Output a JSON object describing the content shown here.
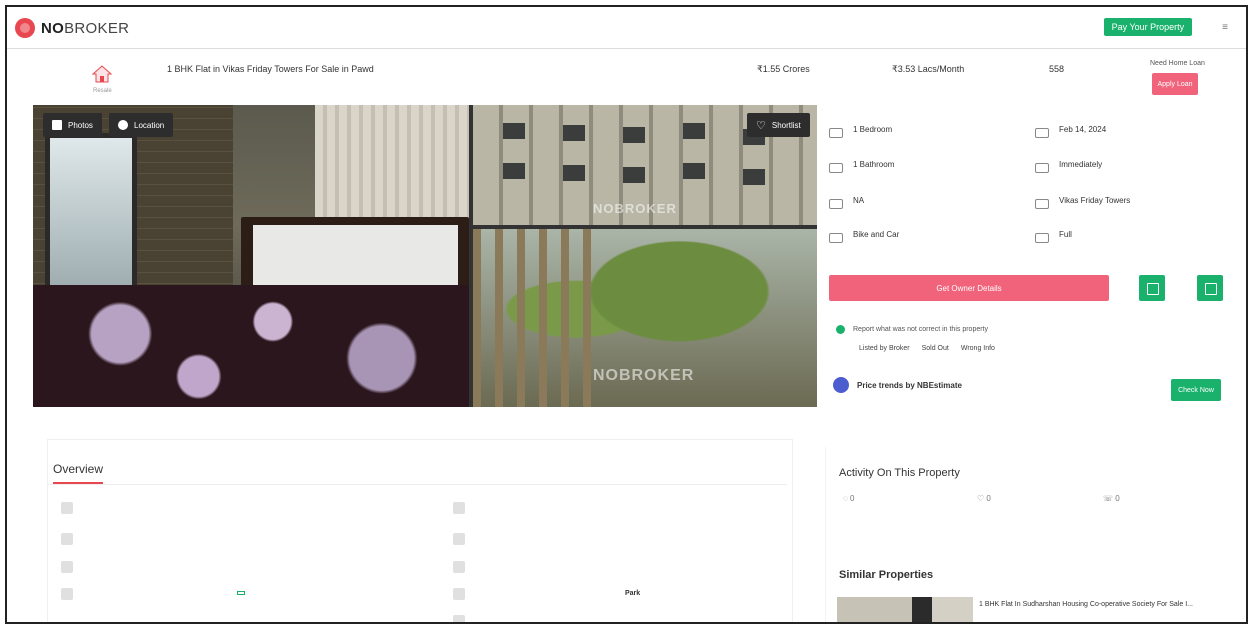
{
  "app": {
    "brand_a": "NO",
    "brand_b": "BROKER"
  },
  "nav": {
    "faded_link": "",
    "pay_label": "Pay Your Property",
    "rent_label": "",
    "buy_label": "",
    "menu_label": ""
  },
  "header": {
    "house_label": "Resale",
    "title": "1 BHK Flat in Vikas Friday Towers For Sale in Pawd",
    "subtitle": "",
    "price_value": "₹1.55 Crores",
    "price_sub": "",
    "emi_value": "₹3.53 Lacs/Month",
    "emi_sub": "",
    "area_value": "558",
    "area_sub": "",
    "loan_head": "Need Home Loan",
    "loan_button": "Apply Loan"
  },
  "breadcrumb": "",
  "gallery": {
    "photos_label": "Photos",
    "location_label": "Location",
    "shortlist_label": "Shortlist",
    "watermark": "NOBROKER"
  },
  "nearby": "",
  "specs": [
    {
      "value": "1 Bedroom",
      "label": ""
    },
    {
      "value": "Feb 14, 2024",
      "label": ""
    },
    {
      "value": "1 Bathroom",
      "label": ""
    },
    {
      "value": "Immediately",
      "label": ""
    },
    {
      "value": "NA",
      "label": ""
    },
    {
      "value": "Vikas Friday Towers",
      "label": ""
    },
    {
      "value": "Bike and Car",
      "label": ""
    },
    {
      "value": "Full",
      "label": ""
    }
  ],
  "contact_button": "Get Owner Details",
  "report": {
    "text": "Report what was not correct in this property",
    "links": [
      "Listed by Broker",
      "Sold Out",
      "Wrong Info"
    ]
  },
  "trend": {
    "label": "Price trends by NBEstimate",
    "button": "Check Now"
  },
  "overview": {
    "tab": "Overview",
    "rows": [
      {
        "label": "",
        "value": ""
      },
      {
        "label": "",
        "value": ""
      },
      {
        "label": "",
        "value": ""
      },
      {
        "label": "",
        "value": "",
        "badge": ""
      },
      {
        "label": "",
        "value": "Park"
      },
      {
        "label": "",
        "value": ""
      }
    ],
    "rows2": [
      {
        "label": "",
        "value": ""
      },
      {
        "label": "",
        "value": ""
      },
      {
        "label": "",
        "value": ""
      },
      {
        "label": "",
        "value": ""
      },
      {
        "label": "",
        "value": ""
      }
    ]
  },
  "activity": {
    "title": "Activity On This Property",
    "items": [
      {
        "count": "0",
        "label": ""
      },
      {
        "count": "0",
        "label": ""
      },
      {
        "count": "0",
        "label": ""
      }
    ],
    "powered": ""
  },
  "similar": {
    "title": "Similar Properties",
    "item_title": "1 BHK Flat In Sudharshan Housing Co-operative Society For Sale I...",
    "item_sub": ""
  },
  "colors": {
    "brand": "#e8474f",
    "green": "#19b16b",
    "pink": "#f0637a"
  }
}
